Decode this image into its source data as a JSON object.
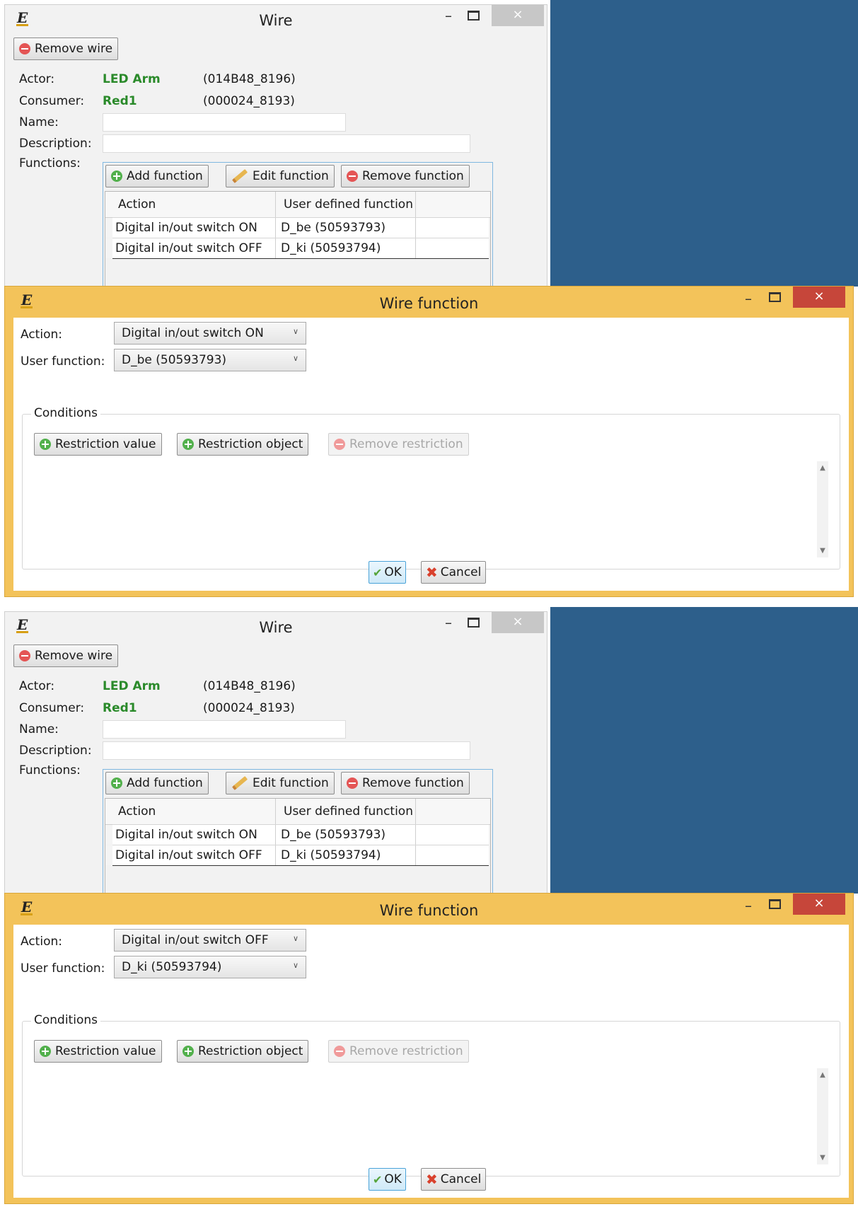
{
  "colors": {
    "desktop": "#2d5f8b",
    "active_title": "#f3c35a",
    "accent_green": "#2a8a2a",
    "close_red": "#c6463a"
  },
  "icons": {
    "app": "app-logo-icon",
    "remove": "remove-icon",
    "add": "add-icon",
    "edit": "pencil-icon",
    "ok": "check-icon",
    "cancel": "x-icon"
  },
  "panels": [
    {
      "wire": {
        "title": "Wire",
        "logo": "E",
        "close": "×",
        "minimize": "–",
        "remove_wire": "Remove wire",
        "actor_label": "Actor:",
        "actor_value": "LED Arm",
        "actor_id": "(014B48_8196)",
        "consumer_label": "Consumer:",
        "consumer_value": "Red1",
        "consumer_id": "(000024_8193)",
        "name_label": "Name:",
        "description_label": "Description:",
        "functions_label": "Functions:",
        "add_function": "Add function",
        "edit_function": "Edit function",
        "remove_function": "Remove function",
        "columns": [
          "Action",
          "User defined function"
        ],
        "rows": [
          {
            "action": "Digital in/out switch ON",
            "function": "D_be (50593793)"
          },
          {
            "action": "Digital in/out switch OFF",
            "function": "D_ki (50593794)"
          }
        ]
      },
      "wire_function": {
        "title": "Wire function",
        "logo": "E",
        "close": "×",
        "minimize": "–",
        "action_label": "Action:",
        "action_value": "Digital in/out switch ON",
        "user_function_label": "User function:",
        "user_function_value": "D_be (50593793)",
        "conditions_label": "Conditions",
        "restriction_value": "Restriction value",
        "restriction_object": "Restriction object",
        "remove_restriction": "Remove restriction",
        "ok": "OK",
        "cancel": "Cancel"
      }
    },
    {
      "wire": {
        "title": "Wire",
        "logo": "E",
        "close": "×",
        "minimize": "–",
        "remove_wire": "Remove wire",
        "actor_label": "Actor:",
        "actor_value": "LED Arm",
        "actor_id": "(014B48_8196)",
        "consumer_label": "Consumer:",
        "consumer_value": "Red1",
        "consumer_id": "(000024_8193)",
        "name_label": "Name:",
        "description_label": "Description:",
        "functions_label": "Functions:",
        "add_function": "Add function",
        "edit_function": "Edit function",
        "remove_function": "Remove function",
        "columns": [
          "Action",
          "User defined function"
        ],
        "rows": [
          {
            "action": "Digital in/out switch ON",
            "function": "D_be (50593793)"
          },
          {
            "action": "Digital in/out switch OFF",
            "function": "D_ki (50593794)"
          }
        ]
      },
      "wire_function": {
        "title": "Wire function",
        "logo": "E",
        "close": "×",
        "minimize": "–",
        "action_label": "Action:",
        "action_value": "Digital in/out switch OFF",
        "user_function_label": "User function:",
        "user_function_value": "D_ki (50593794)",
        "conditions_label": "Conditions",
        "restriction_value": "Restriction value",
        "restriction_object": "Restriction object",
        "remove_restriction": "Remove restriction",
        "ok": "OK",
        "cancel": "Cancel"
      }
    }
  ]
}
